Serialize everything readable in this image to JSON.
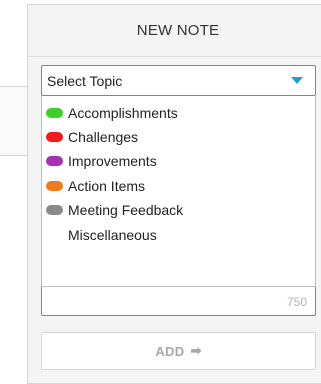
{
  "panel": {
    "title": "NEW NOTE"
  },
  "topic_select": {
    "value": "Select Topic",
    "options": [
      {
        "label": "Accomplishments",
        "color": "#3fcf2b"
      },
      {
        "label": "Challenges",
        "color": "#ee1c1c"
      },
      {
        "label": "Improvements",
        "color": "#a333b3"
      },
      {
        "label": "Action Items",
        "color": "#f07a1f"
      },
      {
        "label": "Meeting Feedback",
        "color": "#8a8a8a"
      },
      {
        "label": "Miscellaneous",
        "color": ""
      }
    ]
  },
  "note_input": {
    "remaining_chars": "750"
  },
  "add_button": {
    "label": "ADD",
    "icon": "arrow-right-icon"
  },
  "colors": {
    "accent": "#27a5d3",
    "panel_bg": "#f4f4f4"
  }
}
